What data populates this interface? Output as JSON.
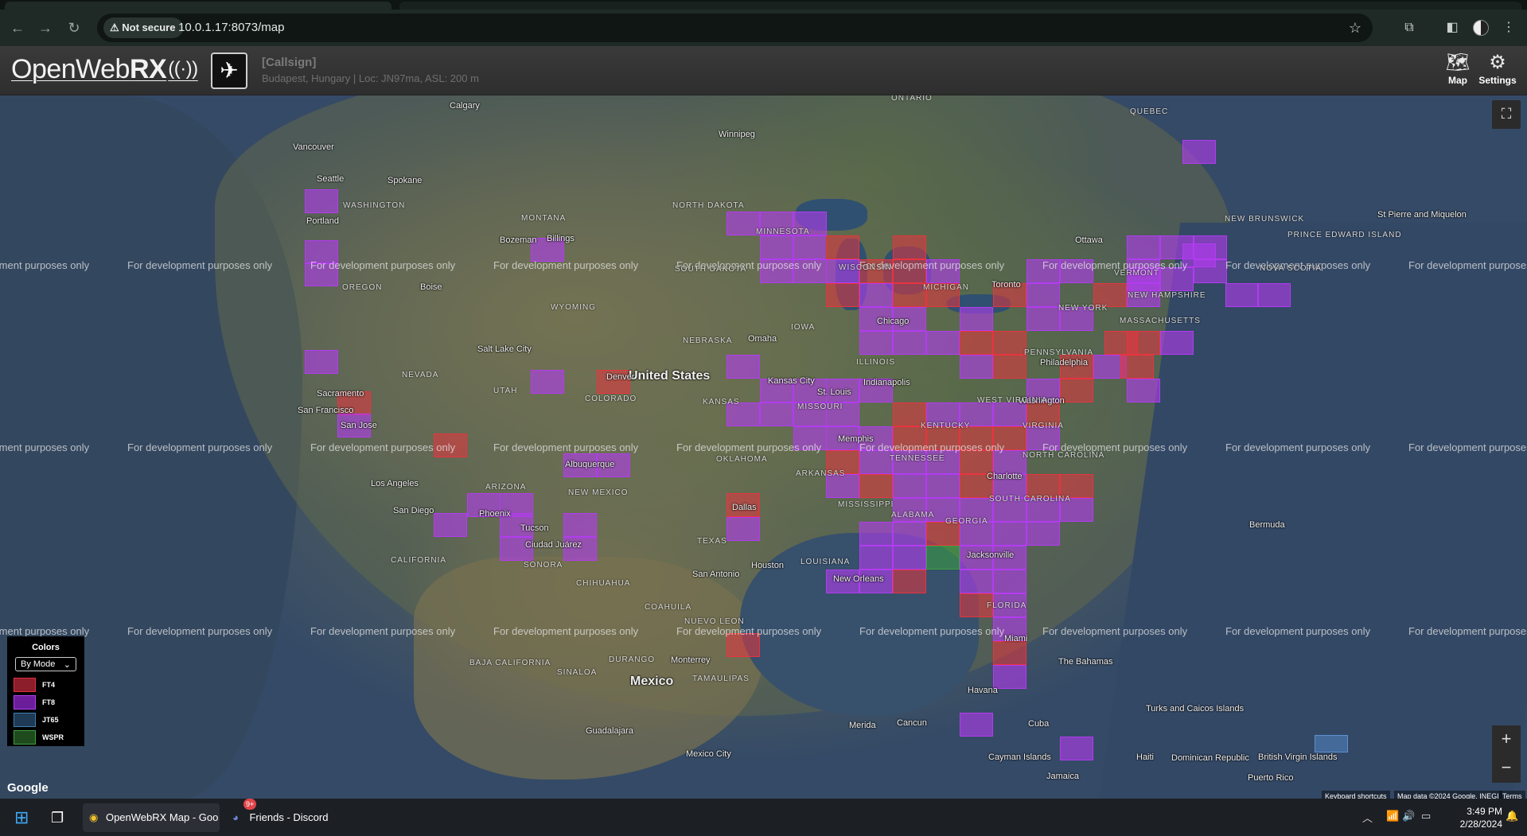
{
  "browser": {
    "security_label": "Not secure",
    "url": "10.0.1.17:8073/map"
  },
  "header": {
    "logo_main": "OpenWeb",
    "logo_bold": "RX",
    "callsign": "[Callsign]",
    "location": "Budapest, Hungary | Loc: JN97ma, ASL: 200 m",
    "map_label": "Map",
    "settings_label": "Settings"
  },
  "map": {
    "watermark": "For development purposes only",
    "big_labels": {
      "us": "United States",
      "mexico": "Mexico"
    },
    "places": [
      "Calgary",
      "Winnipeg",
      "Vancouver",
      "Seattle",
      "Portland",
      "Spokane",
      "Boise",
      "Bozeman",
      "Billings",
      "Salt Lake City",
      "Sacramento",
      "San Francisco",
      "San Jose",
      "Los Angeles",
      "San Diego",
      "Phoenix",
      "Tucson",
      "Albuquerque",
      "Denver",
      "Omaha",
      "Kansas City",
      "St. Louis",
      "Dallas",
      "Houston",
      "San Antonio",
      "New Orleans",
      "Memphis",
      "Chicago",
      "Indianapolis",
      "Toronto",
      "Ottawa",
      "Philadelphia",
      "Washington",
      "Charlotte",
      "Jacksonville",
      "Miami",
      "Havana",
      "Cuba",
      "Bermuda",
      "The Bahamas",
      "Monterrey",
      "Guadalajara",
      "Mexico City",
      "Merida",
      "Cancun",
      "Haiti",
      "Jamaica",
      "Puerto Rico",
      "St Pierre and Miquelon",
      "Ciudad Juárez",
      "Cayman Islands",
      "Dominican Republic",
      "Turks and Caicos Islands",
      "British Virgin Islands"
    ],
    "states": [
      "WASHINGTON",
      "MONTANA",
      "NORTH DAKOTA",
      "SOUTH DAKOTA",
      "MINNESOTA",
      "WISCONSIN",
      "MICHIGAN",
      "OREGON",
      "WYOMING",
      "NEBRASKA",
      "IOWA",
      "ILLINOIS",
      "NEVADA",
      "UTAH",
      "COLORADO",
      "KANSAS",
      "MISSOURI",
      "KENTUCKY",
      "WEST VIRGINIA",
      "VIRGINIA",
      "NEW YORK",
      "VERMONT",
      "NEW HAMPSHIRE",
      "MASSACHUSETTS",
      "PENNSYLVANIA",
      "ARIZONA",
      "NEW MEXICO",
      "OKLAHOMA",
      "ARKANSAS",
      "TENNESSEE",
      "NORTH CAROLINA",
      "SOUTH CAROLINA",
      "MISSISSIPPI",
      "ALABAMA",
      "GEORGIA",
      "TEXAS",
      "LOUISIANA",
      "FLORIDA",
      "CALIFORNIA",
      "BAJA CALIFORNIA",
      "SONORA",
      "CHIHUAHUA",
      "COAHUILA",
      "NUEVO LEON",
      "TAMAULIPAS",
      "DURANGO",
      "SINALOA",
      "QUEBEC",
      "ONTARIO",
      "NEW BRUNSWICK",
      "NOVA SCOTIA",
      "PRINCE EDWARD ISLAND"
    ],
    "keyboard_shortcuts": "Keyboard shortcuts",
    "map_data": "Map data ©2024 Google, INEGI",
    "terms": "Terms",
    "google": "Google"
  },
  "legend": {
    "title": "Colors",
    "select_value": "By Mode",
    "items": [
      {
        "label": "FT4",
        "color": "#8b1e2a",
        "border": "#e03040"
      },
      {
        "label": "FT8",
        "color": "#6a1e9a",
        "border": "#b040f0"
      },
      {
        "label": "JT65",
        "color": "#1f3a55",
        "border": "#3f7fb0"
      },
      {
        "label": "WSPR",
        "color": "#1e4a1e",
        "border": "#40a040"
      }
    ]
  },
  "mode_colors": {
    "FT4": "#e8343f",
    "FT8": "#b23cf0",
    "JT65": "#4a86c0",
    "WSPR": "#3aa040"
  },
  "taskbar": {
    "chrome_task": "OpenWebRX Map - Goo",
    "discord_task": "Friends - Discord",
    "discord_badge": "9+",
    "time": "3:49 PM",
    "date": "2/28/2024"
  }
}
